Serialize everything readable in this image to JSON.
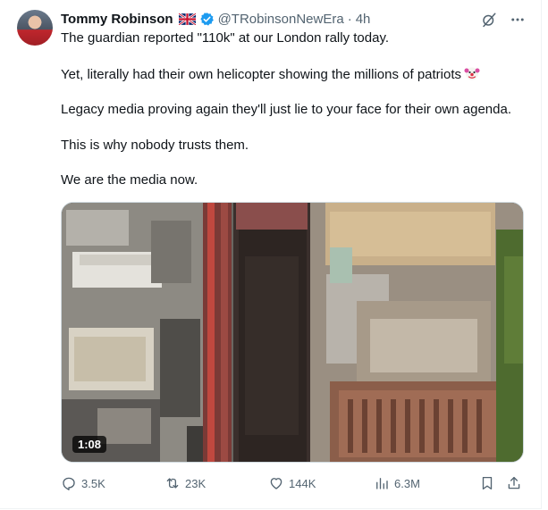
{
  "author": {
    "name": "Tommy Robinson",
    "handle": "@TRobinsonNewEra",
    "separator": "·",
    "time": "4h",
    "flag_icon": "uk-flag-icon",
    "verified_icon": "verified-badge-icon",
    "verified_color": "#1d9bf0"
  },
  "post": {
    "paragraphs": [
      "The guardian reported \"110k\" at our London rally today.",
      "Yet, literally had their own helicopter showing the millions of patriots",
      "Legacy media proving again they'll just lie to your face for their own agenda.",
      "This is why nobody trusts them.",
      "We are the media now."
    ],
    "emoji_icon": "clown-face-emoji-icon"
  },
  "media": {
    "type": "video",
    "duration": "1:08"
  },
  "actions": {
    "replies": "3.5K",
    "reposts": "23K",
    "likes": "144K",
    "views": "6.3M"
  },
  "colors": {
    "text": "#0f1419",
    "secondary": "#536471",
    "accent": "#1d9bf0"
  }
}
